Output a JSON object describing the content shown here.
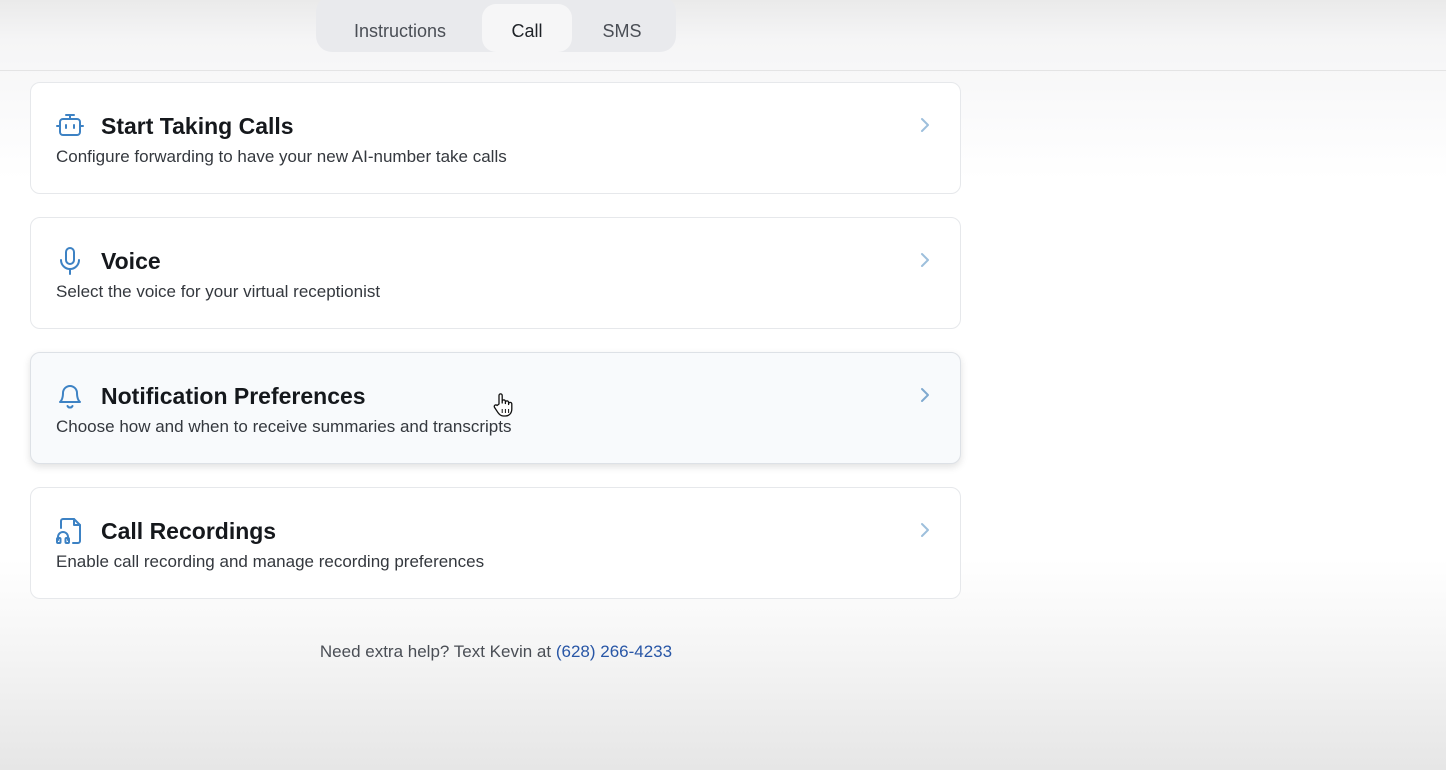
{
  "tabs": [
    {
      "label": "Instructions",
      "active": false
    },
    {
      "label": "Call",
      "active": true
    },
    {
      "label": "SMS",
      "active": false
    }
  ],
  "cards": [
    {
      "icon": "robot-icon",
      "title": "Start Taking Calls",
      "description": "Configure forwarding to have your new AI-number take calls"
    },
    {
      "icon": "microphone-icon",
      "title": "Voice",
      "description": "Select the voice for your virtual receptionist"
    },
    {
      "icon": "bell-icon",
      "title": "Notification Preferences",
      "description": "Choose how and when to receive summaries and transcripts"
    },
    {
      "icon": "audio-file-icon",
      "title": "Call Recordings",
      "description": "Enable call recording and manage recording preferences"
    }
  ],
  "footer": {
    "text": "Need extra help? Text Kevin at",
    "phone": "(628) 266-4233"
  },
  "colors": {
    "icon": "#3d82c4",
    "link": "#2856a6",
    "chevron": "#9dbfdc"
  }
}
